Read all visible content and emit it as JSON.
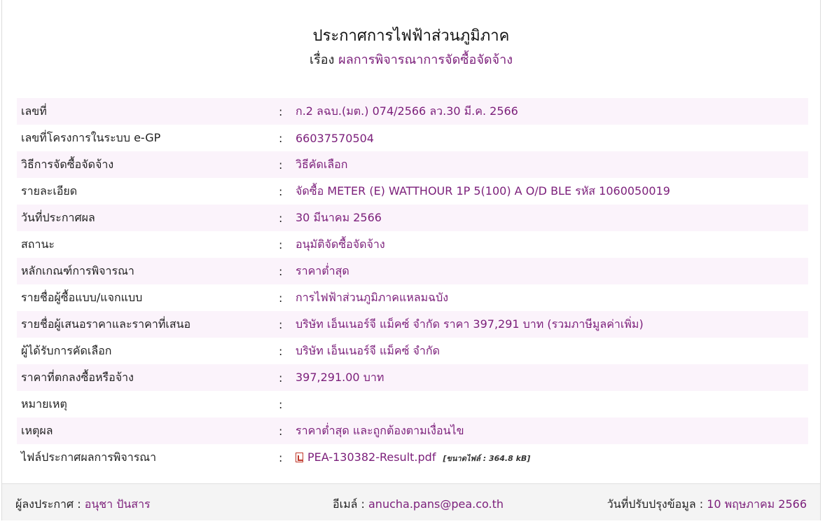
{
  "header": {
    "title": "ประกาศการไฟฟ้าส่วนภูมิภาค",
    "subject_prefix": "เรื่อง",
    "subject": "ผลการพิจารณาการจัดซื้อจัดจ้าง"
  },
  "rows": [
    {
      "label": "เลขที่",
      "value": "ก.2 ลฉบ.(มต.) 074/2566 ลว.30 มี.ค. 2566"
    },
    {
      "label": "เลขที่โครงการในระบบ e-GP",
      "value": "66037570504"
    },
    {
      "label": "วิธีการจัดซื้อจัดจ้าง",
      "value": "วิธีคัดเลือก"
    },
    {
      "label": "รายละเอียด",
      "value": "จัดซื้อ METER (E) WATTHOUR 1P 5(100) A O/D BLE รหัส 1060050019"
    },
    {
      "label": "วันที่ประกาศผล",
      "value": "30 มีนาคม 2566"
    },
    {
      "label": "สถานะ",
      "value": "อนุมัติจัดซื้อจัดจ้าง"
    },
    {
      "label": "หลักเกณฑ์การพิจารณา",
      "value": "ราคาต่ำสุด"
    },
    {
      "label": "รายชื่อผู้ซื้อแบบ/แจกแบบ",
      "value": "การไฟฟ้าส่วนภูมิภาคแหลมฉบัง"
    },
    {
      "label": "รายชื่อผู้เสนอราคาและราคาที่เสนอ",
      "value": "บริษัท เอ็นเนอร์จี แม็คซ์ จำกัด ราคา 397,291 บาท (รวมภาษีมูลค่าเพิ่ม)"
    },
    {
      "label": "ผู้ได้รับการคัดเลือก",
      "value": "บริษัท เอ็นเนอร์จี แม็คซ์ จำกัด"
    },
    {
      "label": "ราคาที่ตกลงซื้อหรือจ้าง",
      "value": "397,291.00 บาท"
    },
    {
      "label": "หมายเหตุ",
      "value": ""
    },
    {
      "label": "เหตุผล",
      "value": "ราคาต่ำสุด และถูกต้องตามเงื่อนไข"
    }
  ],
  "file_row": {
    "label": "ไฟล์ประกาศผลการพิจารณา",
    "file_name": "PEA-130382-Result.pdf",
    "file_size": "[ขนาดไฟล์ : 364.8 kB]",
    "icon": "pdf-file-icon"
  },
  "colon": ":",
  "footer": {
    "announcer_label": "ผู้ลงประกาศ :",
    "announcer": "อนุชา ปันสาร",
    "email_label": "อีเมล์ :",
    "email": "anucha.pans@pea.co.th",
    "updated_label": "วันที่ปรับปรุงข้อมูล :",
    "updated": "10 พฤษภาคม 2566"
  },
  "colors": {
    "accent": "#7b1e7a",
    "row_stripe": "#fbf3fb",
    "footer_bg": "#f4f4f4"
  }
}
